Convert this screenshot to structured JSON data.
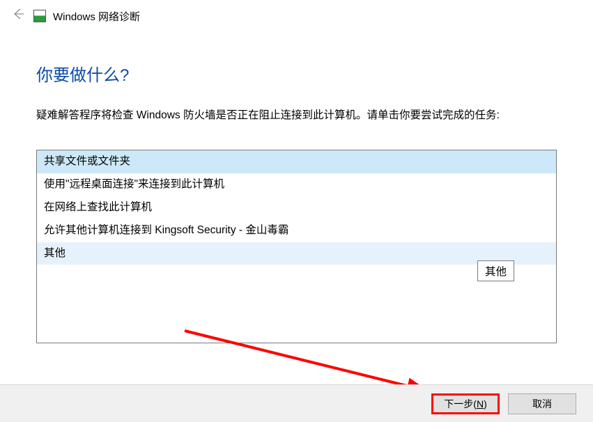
{
  "header": {
    "title": "Windows 网络诊断"
  },
  "main": {
    "heading": "你要做什么?",
    "description": "疑难解答程序将检查 Windows 防火墙是否正在阻止连接到此计算机。请单击你要尝试完成的任务:"
  },
  "options": [
    {
      "label": "共享文件或文件夹",
      "selected": true,
      "highlighted": false
    },
    {
      "label": "使用\"远程桌面连接\"来连接到此计算机",
      "selected": false,
      "highlighted": false
    },
    {
      "label": "在网络上查找此计算机",
      "selected": false,
      "highlighted": false
    },
    {
      "label": "允许其他计算机连接到 Kingsoft Security - 金山毒霸",
      "selected": false,
      "highlighted": false
    },
    {
      "label": "其他",
      "selected": false,
      "highlighted": true
    }
  ],
  "tooltip": {
    "text": "其他"
  },
  "footer": {
    "next_prefix": "下一步(",
    "next_key": "N",
    "next_suffix": ")",
    "cancel": "取消"
  },
  "annotation": {
    "color": "#ff0000"
  }
}
